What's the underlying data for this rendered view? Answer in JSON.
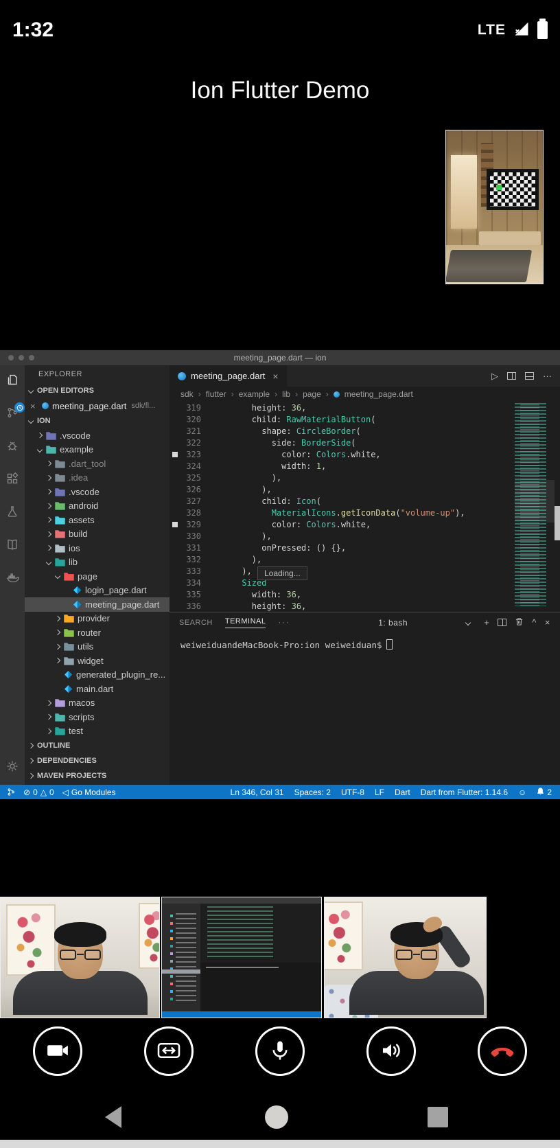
{
  "status_bar": {
    "time": "1:32",
    "network": "LTE"
  },
  "header": {
    "title": "Ion Flutter Demo"
  },
  "glyphs": {
    "close": "×",
    "add": "+",
    "more": "···",
    "collapse": "^",
    "run": "▷",
    "error": "⊘",
    "warning": "△",
    "back_arrow": "◁",
    "smiley": "☺",
    "crumb_sep": "›"
  },
  "vscode": {
    "window_title": "meeting_page.dart — ion",
    "activity_bar": {
      "items": [
        "explorer",
        "source-control",
        "debug",
        "extensions",
        "tests",
        "docs",
        "docker"
      ],
      "bottom": [
        "settings-gear"
      ]
    },
    "sidebar": {
      "title": "EXPLORER",
      "open_editors_label": "OPEN EDITORS",
      "open_editor": {
        "name": "meeting_page.dart",
        "detail": "sdk/fl..."
      },
      "project_label": "ION",
      "tree": [
        {
          "label": ".vscode",
          "indent": 1,
          "state": "closed",
          "kind": "folder",
          "color": "#6f74b8"
        },
        {
          "label": "example",
          "indent": 1,
          "state": "open",
          "kind": "folder",
          "color": "#4db6ac"
        },
        {
          "label": ".dart_tool",
          "indent": 2,
          "state": "closed",
          "kind": "folder",
          "color": "#7e8a93",
          "dim": true
        },
        {
          "label": ".idea",
          "indent": 2,
          "state": "closed",
          "kind": "folder",
          "color": "#7e8a93",
          "dim": true
        },
        {
          "label": ".vscode",
          "indent": 2,
          "state": "closed",
          "kind": "folder",
          "color": "#6f74b8"
        },
        {
          "label": "android",
          "indent": 2,
          "state": "closed",
          "kind": "folder",
          "color": "#67bb6a"
        },
        {
          "label": "assets",
          "indent": 2,
          "state": "closed",
          "kind": "folder",
          "color": "#4dd0e1"
        },
        {
          "label": "build",
          "indent": 2,
          "state": "closed",
          "kind": "folder",
          "color": "#e57373"
        },
        {
          "label": "ios",
          "indent": 2,
          "state": "closed",
          "kind": "folder",
          "color": "#b0bec5"
        },
        {
          "label": "lib",
          "indent": 2,
          "state": "open",
          "kind": "folder",
          "color": "#26a69a"
        },
        {
          "label": "page",
          "indent": 3,
          "state": "open",
          "kind": "folder",
          "color": "#ef5350"
        },
        {
          "label": "login_page.dart",
          "indent": 4,
          "kind": "dart"
        },
        {
          "label": "meeting_page.dart",
          "indent": 4,
          "kind": "dart",
          "selected": true
        },
        {
          "label": "provider",
          "indent": 3,
          "state": "closed",
          "kind": "folder",
          "color": "#ffa726"
        },
        {
          "label": "router",
          "indent": 3,
          "state": "closed",
          "kind": "folder",
          "color": "#8bc34a"
        },
        {
          "label": "utils",
          "indent": 3,
          "state": "closed",
          "kind": "folder",
          "color": "#78909c"
        },
        {
          "label": "widget",
          "indent": 3,
          "state": "closed",
          "kind": "folder",
          "color": "#90a4ae"
        },
        {
          "label": "generated_plugin_re...",
          "indent": 3,
          "kind": "dart"
        },
        {
          "label": "main.dart",
          "indent": 3,
          "kind": "dart"
        },
        {
          "label": "macos",
          "indent": 2,
          "state": "closed",
          "kind": "folder",
          "color": "#b39ddb"
        },
        {
          "label": "scripts",
          "indent": 2,
          "state": "closed",
          "kind": "folder",
          "color": "#4db6ac"
        },
        {
          "label": "test",
          "indent": 2,
          "state": "closed",
          "kind": "folder",
          "color": "#26a69a"
        }
      ],
      "bottom_sections": [
        "OUTLINE",
        "DEPENDENCIES",
        "MAVEN PROJECTS"
      ]
    },
    "editor": {
      "tab_label": "meeting_page.dart",
      "breadcrumbs": [
        "sdk",
        "flutter",
        "example",
        "lib",
        "page",
        "meeting_page.dart"
      ],
      "tooltip": "Loading...",
      "lines": [
        {
          "num": "319",
          "segs": [
            [
              "p",
              "        height: "
            ],
            [
              "n",
              "36"
            ],
            [
              "p",
              ","
            ]
          ]
        },
        {
          "num": "320",
          "segs": [
            [
              "p",
              "        child: "
            ],
            [
              "t",
              "RawMaterialButton"
            ],
            [
              "p",
              "("
            ]
          ]
        },
        {
          "num": "321",
          "segs": [
            [
              "p",
              "          shape: "
            ],
            [
              "t",
              "CircleBorder"
            ],
            [
              "p",
              "("
            ]
          ]
        },
        {
          "num": "322",
          "segs": [
            [
              "p",
              "            side: "
            ],
            [
              "t",
              "BorderSide"
            ],
            [
              "p",
              "("
            ]
          ]
        },
        {
          "num": "323",
          "bp": true,
          "segs": [
            [
              "p",
              "              color: "
            ],
            [
              "t",
              "Colors"
            ],
            [
              "p",
              ".white,"
            ]
          ]
        },
        {
          "num": "324",
          "segs": [
            [
              "p",
              "              width: "
            ],
            [
              "n",
              "1"
            ],
            [
              "p",
              ","
            ]
          ]
        },
        {
          "num": "325",
          "segs": [
            [
              "p",
              "            ),"
            ]
          ]
        },
        {
          "num": "326",
          "segs": [
            [
              "p",
              "          ),"
            ]
          ]
        },
        {
          "num": "327",
          "segs": [
            [
              "p",
              "          child: "
            ],
            [
              "t",
              "Icon"
            ],
            [
              "p",
              "("
            ]
          ]
        },
        {
          "num": "328",
          "segs": [
            [
              "p",
              "            "
            ],
            [
              "t",
              "MaterialIcons"
            ],
            [
              "p",
              "."
            ],
            [
              "f",
              "getIconData"
            ],
            [
              "p",
              "("
            ],
            [
              "s",
              "\"volume-up\""
            ],
            [
              "p",
              "),"
            ]
          ]
        },
        {
          "num": "329",
          "bp": true,
          "segs": [
            [
              "p",
              "            color: "
            ],
            [
              "t",
              "Colors"
            ],
            [
              "p",
              ".white,"
            ]
          ]
        },
        {
          "num": "330",
          "segs": [
            [
              "p",
              "          ),"
            ]
          ]
        },
        {
          "num": "331",
          "segs": [
            [
              "p",
              "          onPressed: () {},"
            ]
          ]
        },
        {
          "num": "332",
          "segs": [
            [
              "p",
              "        ),"
            ]
          ]
        },
        {
          "num": "333",
          "segs": [
            [
              "p",
              "      ),"
            ]
          ]
        },
        {
          "num": "334",
          "segs": [
            [
              "p",
              "      "
            ],
            [
              "t",
              "Sized"
            ]
          ]
        },
        {
          "num": "335",
          "segs": [
            [
              "p",
              "        width: "
            ],
            [
              "n",
              "36"
            ],
            [
              "p",
              ","
            ]
          ]
        },
        {
          "num": "336",
          "segs": [
            [
              "p",
              "        height: "
            ],
            [
              "n",
              "36"
            ],
            [
              "p",
              ","
            ]
          ]
        }
      ]
    },
    "terminal": {
      "tabs": [
        {
          "label": "SEARCH",
          "active": false
        },
        {
          "label": "TERMINAL",
          "active": true
        }
      ],
      "shell": "1: bash",
      "prompt": "weiweiduandeMacBook-Pro:ion weiweiduan$"
    },
    "status": {
      "errors": "0",
      "warnings": "0",
      "go_modules": "Go Modules",
      "line_col": "Ln 346, Col 31",
      "spaces": "Spaces: 2",
      "encoding": "UTF-8",
      "eol": "LF",
      "language": "Dart",
      "sdk": "Dart from Flutter: 1.14.6",
      "notifications": "2"
    },
    "colors": {
      "status_bar": "#0d74c6",
      "type": "#4ec9b0",
      "number": "#b5cea8",
      "string": "#ce9178",
      "function": "#dcdcaa"
    }
  },
  "call": {
    "controls": [
      "camera",
      "switch-camera",
      "microphone",
      "speaker",
      "hang-up"
    ],
    "participants": [
      "local-camera",
      "screen-share",
      "remote-camera"
    ],
    "hangup_color": "#e8453c"
  },
  "android_nav": {
    "buttons": [
      "back",
      "home",
      "recent"
    ]
  }
}
